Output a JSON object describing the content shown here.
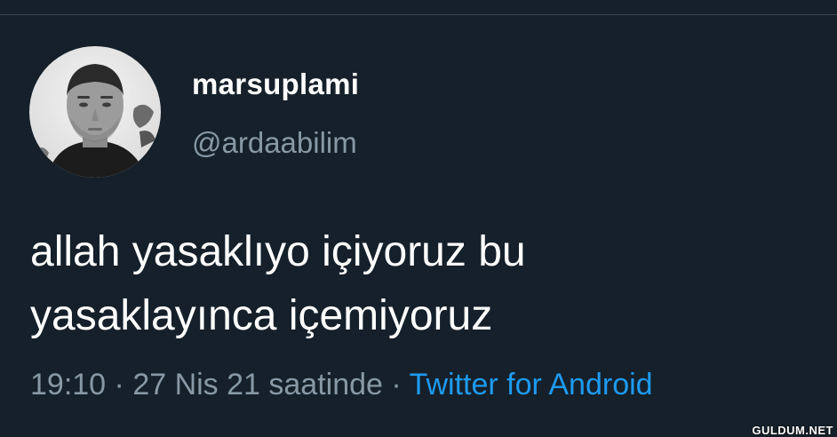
{
  "author": {
    "display_name": "marsuplami",
    "handle": "@ardaabilim"
  },
  "tweet": {
    "line1": "allah yasaklıyo içiyoruz bu",
    "line2": "yasaklayınca içemiyoruz"
  },
  "meta": {
    "time": "19:10",
    "separator1": " · ",
    "date": "27 Nis 21 saatinde",
    "separator2": " · ",
    "source": "Twitter for Android"
  },
  "watermark": "GULDUM.NET",
  "colors": {
    "background": "#15202b",
    "secondary_text": "#8899a6",
    "link": "#1d9bf0"
  }
}
